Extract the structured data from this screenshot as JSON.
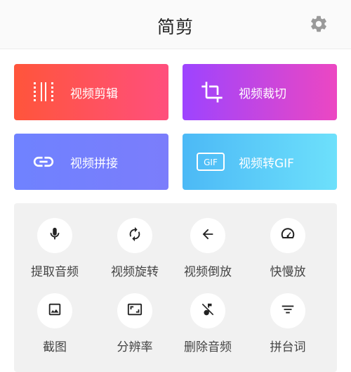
{
  "header": {
    "title": "简剪"
  },
  "cards": {
    "edit": {
      "label": "视频剪辑"
    },
    "crop": {
      "label": "视频裁切"
    },
    "join": {
      "label": "视频拼接"
    },
    "gif": {
      "label": "视频转GIF",
      "icon_text": "GIF"
    }
  },
  "tools": [
    {
      "label": "提取音频",
      "icon": "microphone-icon"
    },
    {
      "label": "视频旋转",
      "icon": "rotate-icon"
    },
    {
      "label": "视频倒放",
      "icon": "arrow-left-icon"
    },
    {
      "label": "快慢放",
      "icon": "speedometer-icon"
    },
    {
      "label": "截图",
      "icon": "image-icon"
    },
    {
      "label": "分辨率",
      "icon": "aspect-ratio-icon"
    },
    {
      "label": "删除音频",
      "icon": "music-off-icon"
    },
    {
      "label": "拼台词",
      "icon": "subtitle-icon"
    }
  ],
  "colors": {
    "edit_gradient": [
      "#ff553b",
      "#ff4f7d"
    ],
    "crop_gradient": [
      "#9d44ff",
      "#ec47c2"
    ],
    "join_gradient": [
      "#6f82ff",
      "#7b7dfb"
    ],
    "gif_gradient": [
      "#4cb9f6",
      "#6de0fb"
    ],
    "tool_panel": "#f1f1f1",
    "icon_dark": "#222222"
  }
}
